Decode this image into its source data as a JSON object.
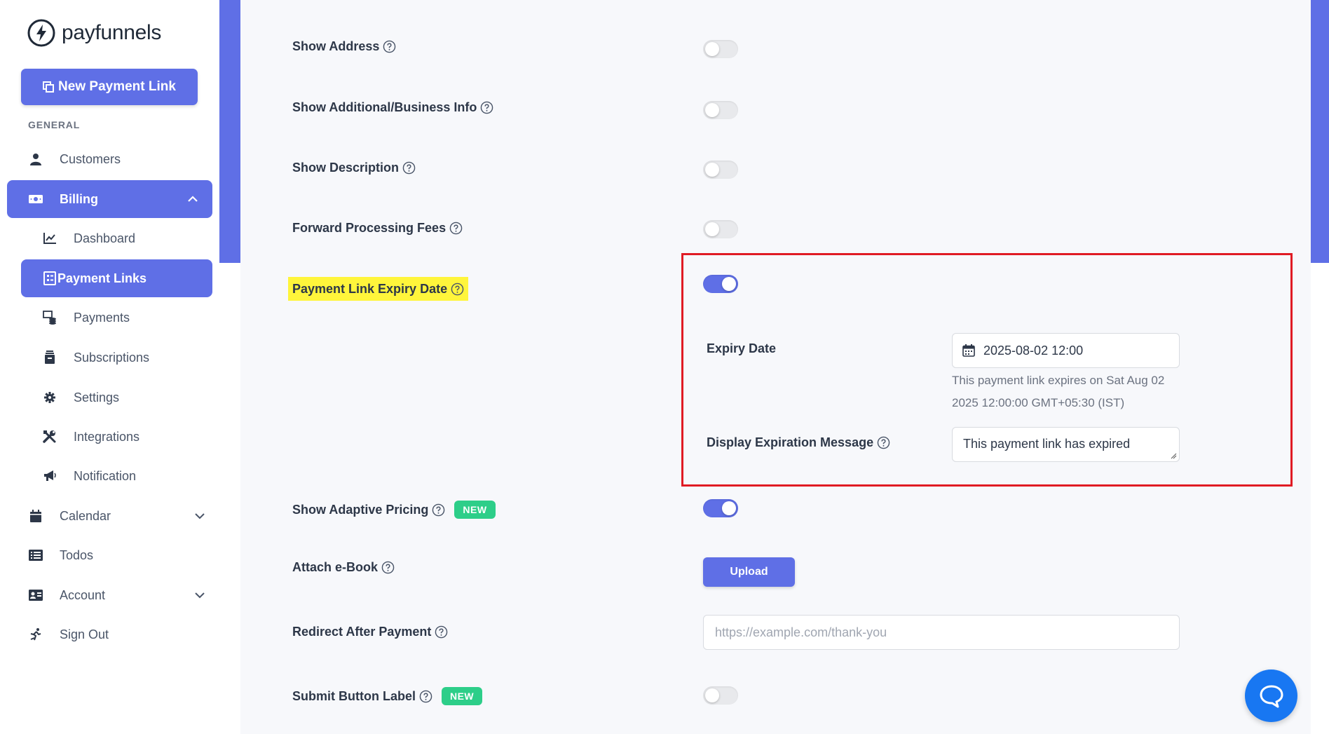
{
  "brand": {
    "name": "payfunnels"
  },
  "sidebar": {
    "new_link_label": "New Payment Link",
    "section_general": "GENERAL",
    "items": [
      {
        "label": "Customers",
        "icon": "user-icon"
      },
      {
        "label": "Billing",
        "icon": "money-bill-icon"
      },
      {
        "label": "Dashboard",
        "icon": "chart-line-icon"
      },
      {
        "label": "Payment Links",
        "icon": "receipt-icon"
      },
      {
        "label": "Payments",
        "icon": "payments-icon"
      },
      {
        "label": "Subscriptions",
        "icon": "archive-icon"
      },
      {
        "label": "Settings",
        "icon": "gear-icon"
      },
      {
        "label": "Integrations",
        "icon": "tools-icon"
      },
      {
        "label": "Notification",
        "icon": "megaphone-icon"
      },
      {
        "label": "Calendar",
        "icon": "calendar-icon"
      },
      {
        "label": "Todos",
        "icon": "list-icon"
      },
      {
        "label": "Account",
        "icon": "id-card-icon"
      },
      {
        "label": "Sign Out",
        "icon": "running-icon"
      }
    ]
  },
  "settings": {
    "show_address": {
      "label": "Show Address",
      "enabled": false
    },
    "show_business_info": {
      "label": "Show Additional/Business Info",
      "enabled": false
    },
    "show_description": {
      "label": "Show Description",
      "enabled": false
    },
    "forward_fees": {
      "label": "Forward Processing Fees",
      "enabled": false
    },
    "expiry": {
      "label": "Payment Link Expiry Date",
      "enabled": true,
      "date_label": "Expiry Date",
      "date_value": "2025-08-02 12:00",
      "date_hint": "This payment link expires on Sat Aug 02 2025 12:00:00 GMT+05:30 (IST)",
      "message_label": "Display Expiration Message",
      "message_value": "This payment link has expired"
    },
    "adaptive_pricing": {
      "label": "Show Adaptive Pricing",
      "badge": "NEW",
      "enabled": true
    },
    "ebook": {
      "label": "Attach e-Book",
      "button": "Upload"
    },
    "redirect": {
      "label": "Redirect After Payment",
      "placeholder": "https://example.com/thank-you"
    },
    "submit_label": {
      "label": "Submit Button Label",
      "badge": "NEW",
      "enabled": false
    }
  },
  "colors": {
    "accent": "#5f6fe6",
    "badge_green": "#2dce89",
    "highlight": "#fff53b",
    "annotation_red": "#e01b24",
    "chat_blue": "#1877f2"
  }
}
